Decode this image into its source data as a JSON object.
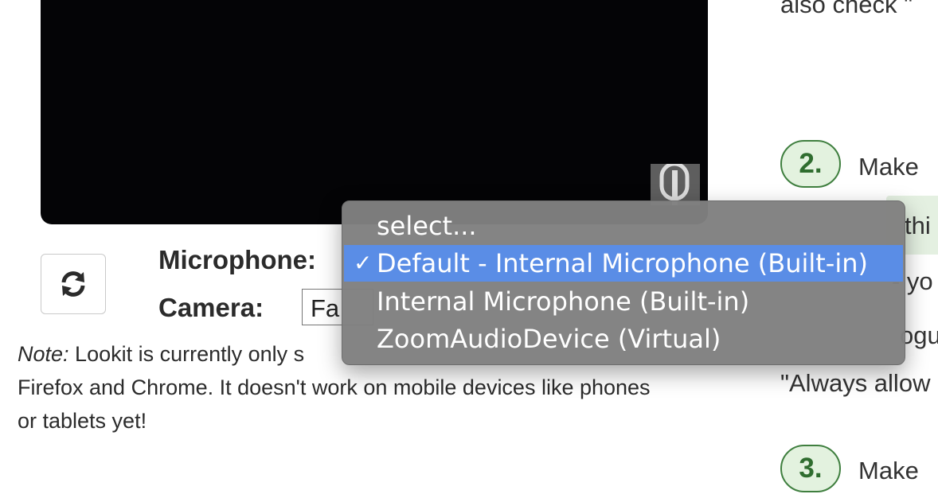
{
  "video": {
    "mic_icon": "microphone-icon"
  },
  "controls": {
    "refresh_icon": "refresh-icon",
    "microphone_label": "Microphone:",
    "camera_label": "Camera:",
    "camera_value": "Fa"
  },
  "note": {
    "prefix": "Note:",
    "line1": " Lookit is currently only s",
    "line2": "Firefox and Chrome. It doesn't work on mobile devices like phones",
    "line3": "or tablets yet!"
  },
  "right": {
    "top_text": "also check \"",
    "step2_number": "2.",
    "step2_text": "Make",
    "box_text": "thi",
    "frag1": "- yo",
    "frag2": "ogu",
    "frag3": "\"Always allow",
    "step3_number": "3.",
    "step3_text": "Make"
  },
  "dropdown": {
    "options": [
      {
        "label": "select..."
      },
      {
        "label": "Default - Internal Microphone (Built-in)",
        "check": "✓"
      },
      {
        "label": "Internal Microphone (Built-in)"
      },
      {
        "label": "ZoomAudioDevice (Virtual)"
      }
    ]
  },
  "colors": {
    "video_bg": "#040406",
    "dropdown_bg": "#808080",
    "selected_option": "#5a8de6",
    "step_badge_bg": "#e3f2df",
    "step_badge_text": "#2f6d2f"
  }
}
